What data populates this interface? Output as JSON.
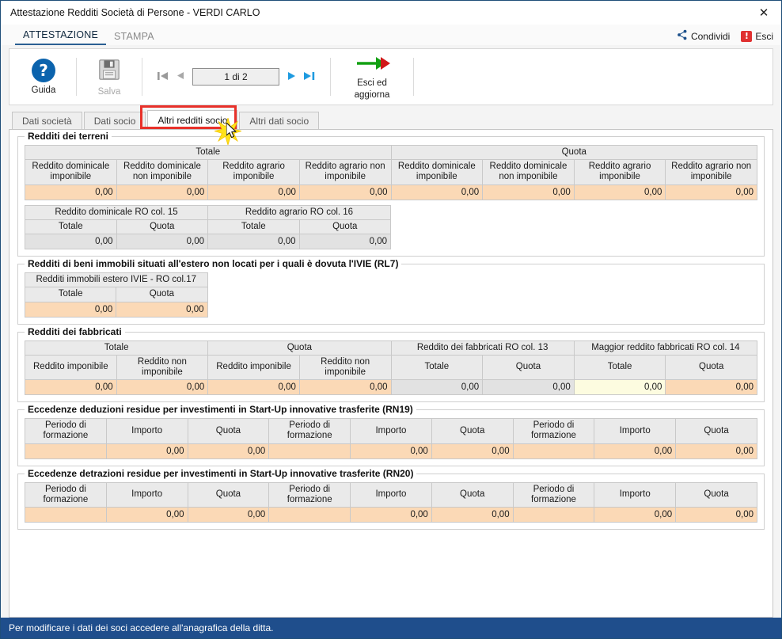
{
  "window": {
    "title": "Attestazione Redditi Società di Persone - VERDI CARLO",
    "close_label": "✕"
  },
  "ribbon": {
    "tabs": [
      {
        "label": "ATTESTAZIONE",
        "active": true
      },
      {
        "label": "STAMPA",
        "active": false
      }
    ],
    "right_actions": [
      {
        "label": "Condividi",
        "icon": "share-icon"
      },
      {
        "label": "Esci",
        "icon": "exit-icon",
        "icon_glyph": "!"
      }
    ],
    "accent_color": "#2a5f92",
    "exit_color": "#e03030"
  },
  "toolbar": {
    "guida_label": "Guida",
    "guida_icon_glyph": "?",
    "salva_label": "Salva",
    "nav": {
      "first_glyph": "◀|",
      "prev_glyph": "◀",
      "page_value": "1 di 2",
      "next_glyph": "▶",
      "last_glyph": "|▶"
    },
    "esci_aggiorna_line1": "Esci ed",
    "esci_aggiorna_line2": "aggiorna"
  },
  "tabs": [
    {
      "label": "Dati società",
      "active": false
    },
    {
      "label": "Dati socio",
      "active": false
    },
    {
      "label": "Altri redditi socio",
      "active": true
    },
    {
      "label": "Altri dati socio",
      "active": false
    }
  ],
  "highlight_color": "#e8312a",
  "sections": {
    "terreni": {
      "legend": "Redditi dei terreni",
      "group_headers": [
        {
          "label": "Totale",
          "span": 4
        },
        {
          "label": "Quota",
          "span": 4
        }
      ],
      "columns": [
        "Reddito dominicale imponibile",
        "Reddito dominicale non imponibile",
        "Reddito agrario imponibile",
        "Reddito agrario non imponibile",
        "Reddito dominicale imponibile",
        "Reddito dominicale non imponibile",
        "Reddito agrario imponibile",
        "Reddito agrario non imponibile"
      ],
      "values": [
        "0,00",
        "0,00",
        "0,00",
        "0,00",
        "0,00",
        "0,00",
        "0,00",
        "0,00"
      ],
      "sub": {
        "group_headers": [
          {
            "label": "Reddito dominicale RO col. 15",
            "span": 2
          },
          {
            "label": "Reddito agrario RO col. 16",
            "span": 2
          }
        ],
        "columns": [
          "Totale",
          "Quota",
          "Totale",
          "Quota"
        ],
        "values": [
          "0,00",
          "0,00",
          "0,00",
          "0,00"
        ],
        "cell_styles": [
          "grey",
          "grey",
          "grey",
          "grey"
        ]
      }
    },
    "ivie": {
      "legend": "Redditi di beni immobili situati all'estero non locati per i quali è dovuta l'IVIE (RL7)",
      "group_headers": [
        {
          "label": "Redditi immobili estero IVIE - RO col.17",
          "span": 2
        }
      ],
      "columns": [
        "Totale",
        "Quota"
      ],
      "values": [
        "0,00",
        "0,00"
      ],
      "cell_styles": [
        "orange",
        "orange"
      ]
    },
    "fabbricati": {
      "legend": "Redditi dei fabbricati",
      "group_headers": [
        {
          "label": "Totale",
          "span": 2
        },
        {
          "label": "Quota",
          "span": 2
        },
        {
          "label": "Reddito dei fabbricati RO col. 13",
          "span": 2
        },
        {
          "label": "Maggior reddito fabbricati RO col. 14",
          "span": 2
        }
      ],
      "columns": [
        "Reddito imponibile",
        "Reddito non imponibile",
        "Reddito imponibile",
        "Reddito non imponibile",
        "Totale",
        "Quota",
        "Totale",
        "Quota"
      ],
      "values": [
        "0,00",
        "0,00",
        "0,00",
        "0,00",
        "0,00",
        "0,00",
        "0,00",
        "0,00"
      ],
      "cell_styles": [
        "orange",
        "orange",
        "orange",
        "orange",
        "grey",
        "grey",
        "focus",
        "orange"
      ]
    },
    "rn19": {
      "legend": "Eccedenze deduzioni residue per investimenti in Start-Up innovative trasferite (RN19)",
      "columns": [
        "Periodo di formazione",
        "Importo",
        "Quota",
        "Periodo di formazione",
        "Importo",
        "Quota",
        "Periodo di formazione",
        "Importo",
        "Quota"
      ],
      "values": [
        "",
        "0,00",
        "0,00",
        "",
        "0,00",
        "0,00",
        "",
        "0,00",
        "0,00"
      ]
    },
    "rn20": {
      "legend": "Eccedenze detrazioni residue per investimenti in Start-Up innovative trasferite (RN20)",
      "columns": [
        "Periodo di formazione",
        "Importo",
        "Quota",
        "Periodo di formazione",
        "Importo",
        "Quota",
        "Periodo di formazione",
        "Importo",
        "Quota"
      ],
      "values": [
        "",
        "0,00",
        "0,00",
        "",
        "0,00",
        "0,00",
        "",
        "0,00",
        "0,00"
      ]
    }
  },
  "statusbar": {
    "message": "Per modificare i dati dei soci accedere all'anagrafica della ditta.",
    "background": "#1f4e8c"
  }
}
